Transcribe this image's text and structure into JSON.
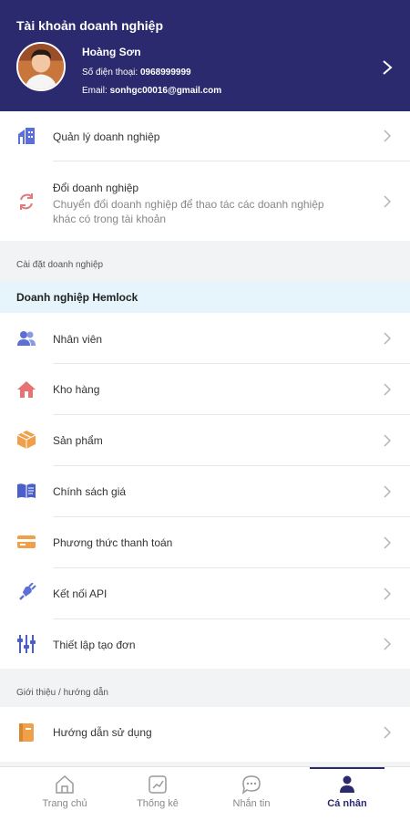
{
  "header": {
    "title": "Tài khoản doanh nghiệp",
    "name": "Hoàng Sơn",
    "phone_label": "Số điện thoại:",
    "phone": "0968999999",
    "email_label": "Email:",
    "email": "sonhgc00016@gmail.com"
  },
  "top_items": {
    "manage": {
      "label": "Quản lý doanh nghiệp"
    },
    "switch": {
      "label": "Đổi doanh nghiệp",
      "sub": "Chuyển đổi doanh nghiệp để thao tác các doanh nghiệp khác có trong tài khoản"
    }
  },
  "settings": {
    "section": "Cài đặt doanh nghiệp",
    "company": "Doanh nghiệp Hemlock",
    "items": [
      {
        "label": "Nhân viên",
        "icon": "people-icon"
      },
      {
        "label": "Kho hàng",
        "icon": "home-icon"
      },
      {
        "label": "Sản phẩm",
        "icon": "box-icon"
      },
      {
        "label": "Chính sách giá",
        "icon": "book-icon"
      },
      {
        "label": "Phương thức thanh toán",
        "icon": "card-icon"
      },
      {
        "label": "Kết nối API",
        "icon": "plug-icon"
      },
      {
        "label": "Thiết lập tạo đơn",
        "icon": "sliders-icon"
      }
    ]
  },
  "guide": {
    "section": "Giới thiệu / hướng dẫn",
    "items": [
      {
        "label": "Hướng dẫn sử dụng",
        "icon": "guide-book-icon"
      }
    ]
  },
  "tabbar": {
    "tabs": [
      {
        "label": "Trang chủ",
        "icon": "home-outline-icon"
      },
      {
        "label": "Thống kê",
        "icon": "chart-icon"
      },
      {
        "label": "Nhắn tin",
        "icon": "chat-icon"
      },
      {
        "label": "Cá nhân",
        "icon": "person-icon"
      }
    ],
    "active": "Cá nhân"
  },
  "colors": {
    "header_bg": "#2b2a6e",
    "accent": "#2b2a6e",
    "company_band": "#e6f4fb"
  }
}
